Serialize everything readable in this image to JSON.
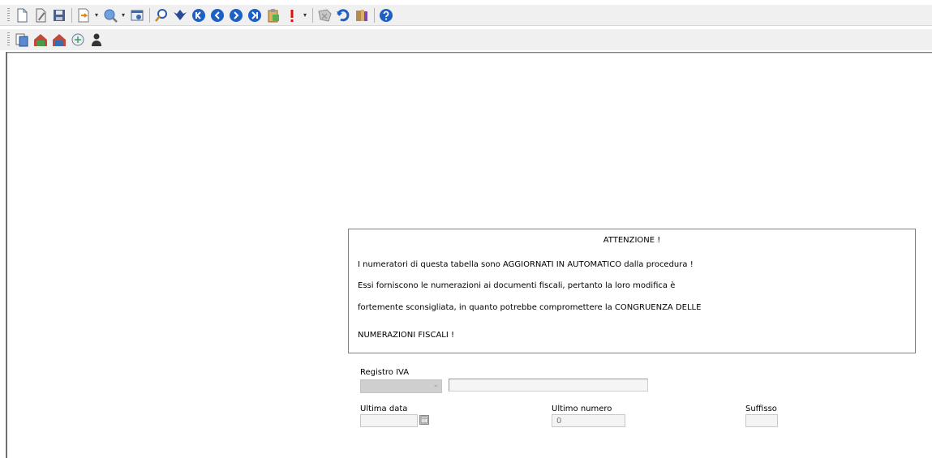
{
  "toolbar1": {
    "buttons": [
      {
        "icon": "new-document-icon"
      },
      {
        "icon": "edit-document-icon"
      },
      {
        "icon": "save-icon"
      },
      {
        "icon": "export-icon",
        "dropdown": true
      },
      {
        "icon": "search-globe-icon",
        "dropdown": true
      },
      {
        "icon": "settings-window-icon"
      },
      {
        "icon": "magnifier-icon"
      },
      {
        "icon": "filter-icon"
      },
      {
        "icon": "first-record-icon"
      },
      {
        "icon": "previous-record-icon"
      },
      {
        "icon": "next-record-icon"
      },
      {
        "icon": "last-record-icon"
      },
      {
        "icon": "clipboard-icon"
      },
      {
        "icon": "alert-icon",
        "dropdown": true
      },
      {
        "icon": "delete-icon"
      },
      {
        "icon": "undo-icon"
      },
      {
        "icon": "archive-icon"
      },
      {
        "icon": "help-icon"
      }
    ]
  },
  "toolbar2": {
    "buttons": [
      {
        "icon": "report-icon"
      },
      {
        "icon": "building-icon"
      },
      {
        "icon": "building-alt-icon"
      },
      {
        "icon": "shield-icon"
      },
      {
        "icon": "user-icon"
      }
    ]
  },
  "warning": {
    "title": "ATTENZIONE !",
    "lines": [
      "I numeratori di questa tabella sono AGGIORNATI IN AUTOMATICO dalla procedura !",
      "Essi forniscono le numerazioni ai documenti fiscali, pertanto la loro modifica è",
      "fortemente sconsigliata, in quanto potrebbe compromettere la CONGRUENZA DELLE",
      "NUMERAZIONI FISCALI !"
    ]
  },
  "form": {
    "registro_label": "Registro IVA",
    "registro_value": "",
    "registro_desc": "",
    "ultima_data_label": "Ultima data",
    "ultima_data_value": "",
    "ultimo_numero_label": "Ultimo numero",
    "ultimo_numero_value": "0",
    "suffisso_label": "Suffisso",
    "suffisso_value": ""
  },
  "colors": {
    "blue_nav": "#1e5fc4",
    "alert_red": "#e01010",
    "toolbar_bg": "#f0f0f0"
  }
}
